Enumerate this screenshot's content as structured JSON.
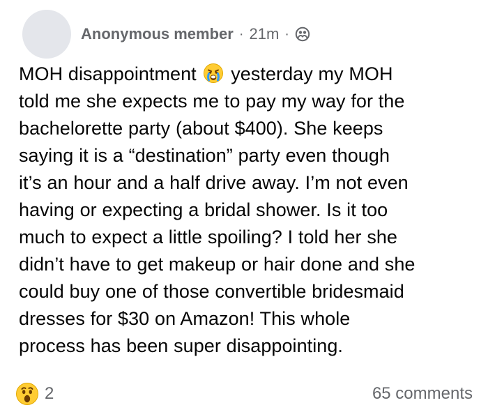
{
  "post": {
    "author": "Anonymous member",
    "time": "21m",
    "separator": "·",
    "audience_icon": "group-privacy-icon",
    "title_prefix": "MOH disappointment",
    "title_emoji": "crying-face-icon",
    "lines": [
      "yesterday my MOH",
      "told me she expects me to pay my way for the",
      "bachelorette party (about $400). She keeps",
      "saying it is a “destination” party even though",
      "it’s an hour and a half drive away. I’m not even",
      "having or expecting a bridal shower. Is it too",
      "much to expect a little spoiling? I told her she",
      "didn’t have to get makeup or hair done and she",
      "could buy one of those convertible bridesmaid",
      "dresses for $30 on Amazon! This whole",
      "process has been super disappointing."
    ],
    "reactions": {
      "emoji": "wow-face-icon",
      "count": "2"
    },
    "comments_label": "65 comments",
    "colors": {
      "text": "#050505",
      "meta": "#65676b",
      "avatar": "#e4e6eb",
      "emoji": "#ffcc33"
    }
  }
}
